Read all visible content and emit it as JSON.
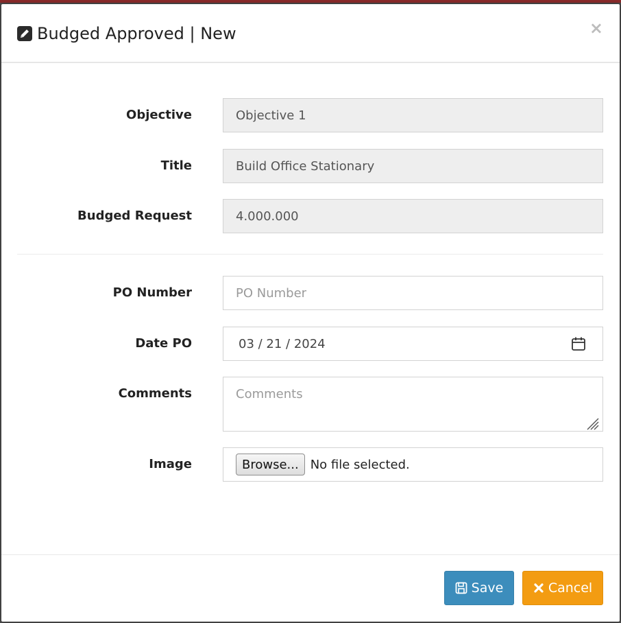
{
  "modal": {
    "title": "Budged Approved | New",
    "close_glyph": "×",
    "header_icon": "pencil-square-icon"
  },
  "form": {
    "objective": {
      "label": "Objective",
      "value": "Objective 1"
    },
    "title": {
      "label": "Title",
      "value": "Build Office Stationary"
    },
    "budged_request": {
      "label": "Budged Request",
      "value": "4.000.000"
    },
    "po_number": {
      "label": "PO Number",
      "value": "",
      "placeholder": "PO Number"
    },
    "date_po": {
      "label": "Date PO",
      "value": "03 / 21 / 2024"
    },
    "comments": {
      "label": "Comments",
      "value": "",
      "placeholder": "Comments"
    },
    "image": {
      "label": "Image",
      "browse_label": "Browse...",
      "status": "No file selected."
    }
  },
  "footer": {
    "save_label": "Save",
    "cancel_label": "Cancel"
  },
  "colors": {
    "primary": "#3c8dbc",
    "warning": "#f39c12",
    "readonly_bg": "#eeeeee"
  }
}
